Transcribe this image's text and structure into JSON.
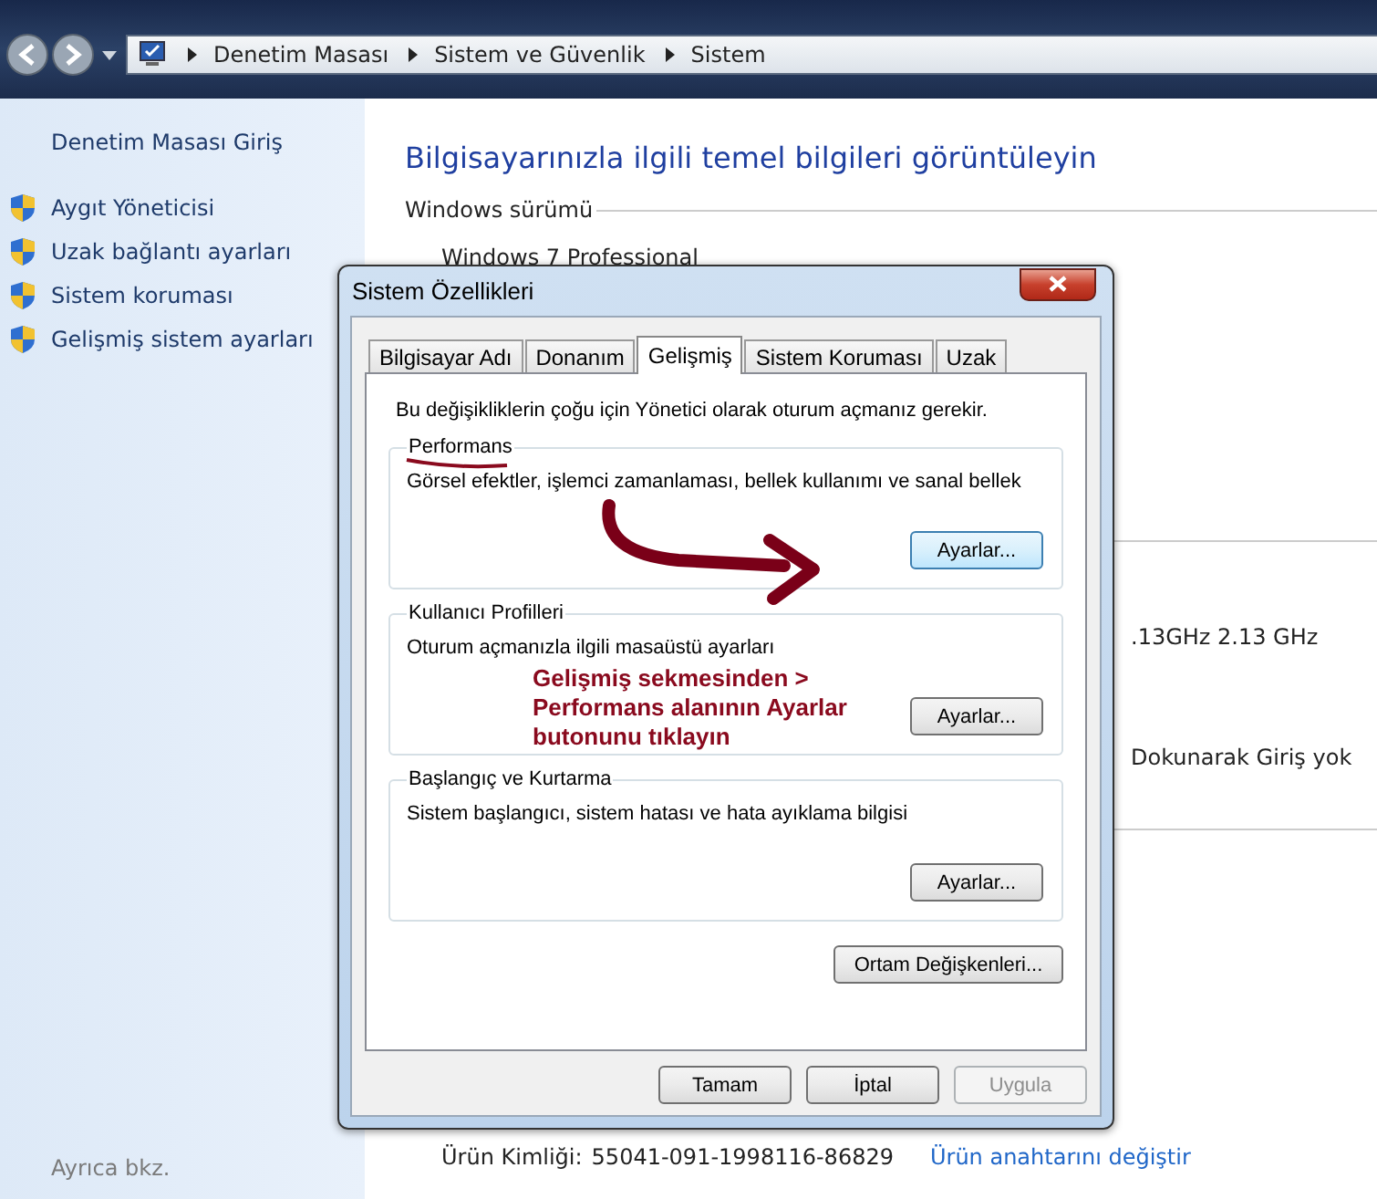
{
  "breadcrumb": [
    "Denetim Masası",
    "Sistem ve Güvenlik",
    "Sistem"
  ],
  "sidebar": {
    "home": "Denetim Masası Giriş",
    "links": [
      "Aygıt Yöneticisi",
      "Uzak bağlantı ayarları",
      "Sistem koruması",
      "Gelişmiş sistem ayarları"
    ],
    "see_also": "Ayrıca bkz."
  },
  "main": {
    "title": "Bilgisayarınızla ilgili temel bilgileri görüntüleyin",
    "section": "Windows sürümü",
    "edition": "Windows 7 Professional",
    "processor_fragment": ".13GHz   2.13 GHz",
    "touch_fragment": "Dokunarak Giriş yok",
    "product_id_label": "Ürün Kimliği:",
    "product_id": "55041-091-1998116-86829",
    "change_key_link": "Ürün anahtarını değiştir"
  },
  "dialog": {
    "title": "Sistem Özellikleri",
    "tabs": [
      {
        "label": "Bilgisayar Adı",
        "selected": false
      },
      {
        "label": "Donanım",
        "selected": false
      },
      {
        "label": "Gelişmiş",
        "selected": true
      },
      {
        "label": "Sistem Koruması",
        "selected": false
      },
      {
        "label": "Uzak",
        "selected": false
      }
    ],
    "note": "Bu değişikliklerin çoğu için Yönetici olarak oturum açmanız gerekir.",
    "groups": [
      {
        "title": "Performans",
        "description": "Görsel efektler, işlemci zamanlaması, bellek kullanımı ve sanal bellek",
        "button": "Ayarlar..."
      },
      {
        "title": "Kullanıcı Profilleri",
        "description": "Oturum açmanızla ilgili masaüstü ayarları",
        "button": "Ayarlar..."
      },
      {
        "title": "Başlangıç ve Kurtarma",
        "description": "Sistem başlangıcı, sistem hatası ve hata ayıklama bilgisi",
        "button": "Ayarlar..."
      }
    ],
    "env_button": "Ortam Değişkenleri...",
    "buttons": [
      {
        "label": "Tamam",
        "disabled": false
      },
      {
        "label": "İptal",
        "disabled": false
      },
      {
        "label": "Uygula",
        "disabled": true
      }
    ]
  },
  "annotation": {
    "lines": [
      "Gelişmiş sekmesinden >",
      "Performans alanının Ayarlar",
      "butonunu tıklayın"
    ]
  }
}
